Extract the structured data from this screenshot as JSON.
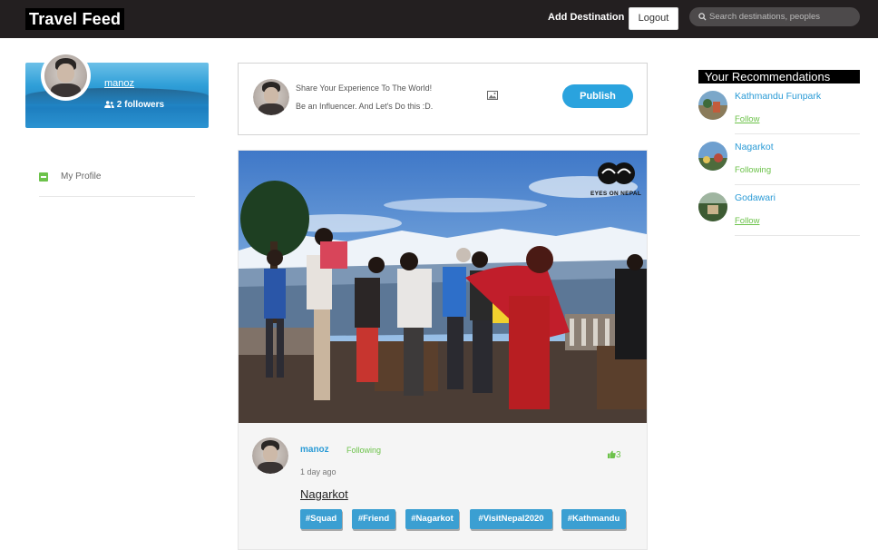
{
  "navbar": {
    "brand": "Travel Feed",
    "add_destination": "Add Destination",
    "logout": "Logout",
    "search_placeholder": "Search destinations, peoples"
  },
  "profile": {
    "name": "manoz",
    "followers": "2 followers"
  },
  "side_menu": [
    {
      "label": "My Profile",
      "icon": "minus-square-icon"
    }
  ],
  "composer": {
    "line1": "Share Your Experience To The World!",
    "line2": "Be an Influencer. And Let's Do this :D.",
    "publish": "Publish"
  },
  "post": {
    "watermark": "EYES ON NEPAL",
    "user": "manoz",
    "follow_status": "Following",
    "time": "1 day ago",
    "likes": "3",
    "title": "Nagarkot",
    "tags": [
      "#Squad",
      "#Friend",
      "#Nagarkot",
      "#VisitNepal2020",
      "#Kathmandu"
    ]
  },
  "recommendations": {
    "title": "Your Recommendations",
    "items": [
      {
        "name": "Kathmandu Funpark",
        "action": "Follow"
      },
      {
        "name": "Nagarkot",
        "action": "Following"
      },
      {
        "name": "Godawari",
        "action": "Follow"
      }
    ]
  },
  "colors": {
    "navbar": "#231f20",
    "accent_blue": "#2aa3de",
    "accent_green": "#6cc24a",
    "tag_blue": "#3b9fd2"
  }
}
